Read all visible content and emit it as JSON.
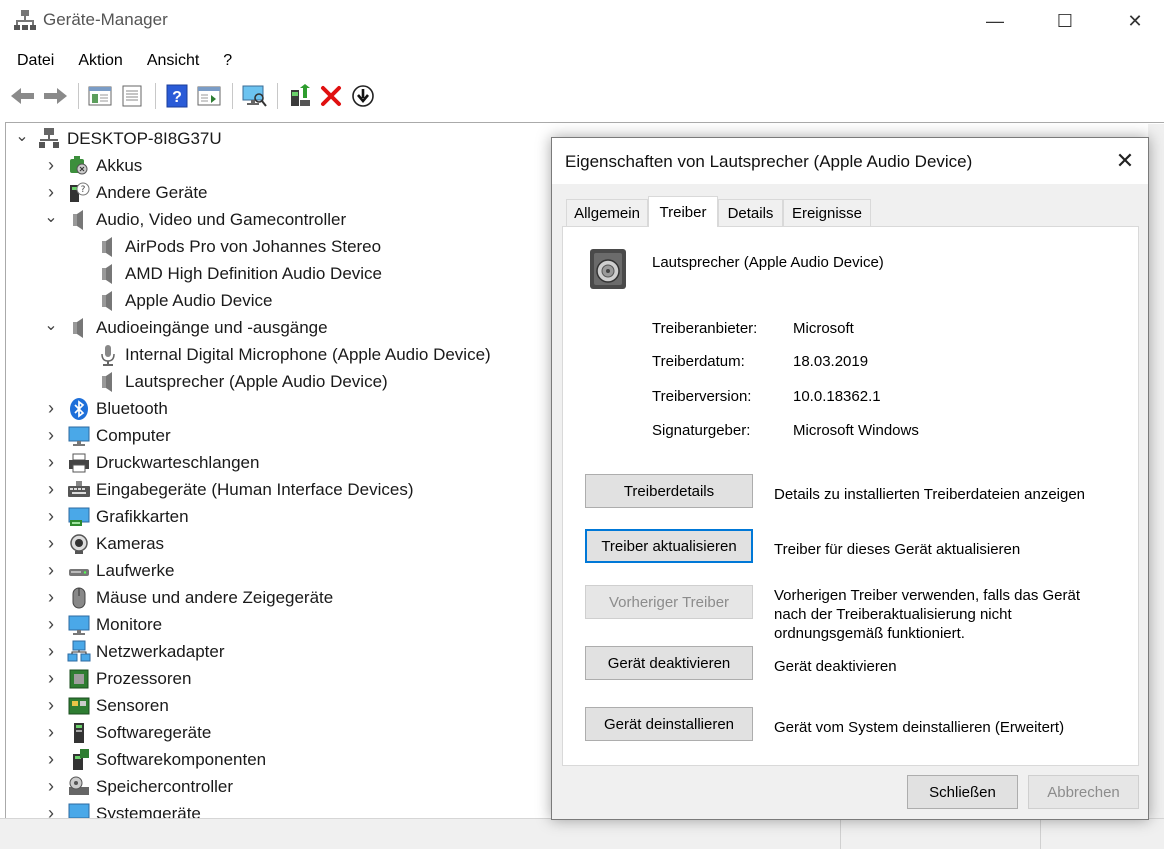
{
  "window": {
    "title": "Geräte-Manager",
    "controls": {
      "minimize": "—",
      "maximize": "☐",
      "close": "✕"
    }
  },
  "menu": [
    "Datei",
    "Aktion",
    "Ansicht",
    "?"
  ],
  "toolbar": [
    "back-arrow-icon",
    "forward-arrow-icon",
    "console-tree-icon",
    "properties-icon",
    "help-icon",
    "action-pane-icon",
    "scan-monitor-icon",
    "update-driver-icon",
    "uninstall-x-icon",
    "download-driver-icon"
  ],
  "tree": [
    {
      "label": "DESKTOP-8I8G37U",
      "level": 0,
      "state": "expanded",
      "icon": "computer-root-icon"
    },
    {
      "label": "Akkus",
      "level": 1,
      "state": "collapsed",
      "icon": "battery-icon"
    },
    {
      "label": "Andere Geräte",
      "level": 1,
      "state": "collapsed",
      "icon": "unknown-device-icon"
    },
    {
      "label": "Audio, Video und Gamecontroller",
      "level": 1,
      "state": "expanded",
      "icon": "speaker-icon"
    },
    {
      "label": "AirPods Pro von Johannes Stereo",
      "level": 2,
      "state": "leaf",
      "icon": "speaker-icon"
    },
    {
      "label": "AMD High Definition Audio Device",
      "level": 2,
      "state": "leaf",
      "icon": "speaker-icon"
    },
    {
      "label": "Apple Audio Device",
      "level": 2,
      "state": "leaf",
      "icon": "speaker-icon"
    },
    {
      "label": "Audioeingänge und -ausgänge",
      "level": 1,
      "state": "expanded",
      "icon": "speaker-icon"
    },
    {
      "label": "Internal Digital Microphone (Apple Audio Device)",
      "level": 2,
      "state": "leaf",
      "icon": "microphone-icon"
    },
    {
      "label": "Lautsprecher (Apple Audio Device)",
      "level": 2,
      "state": "leaf",
      "icon": "speaker-icon"
    },
    {
      "label": "Bluetooth",
      "level": 1,
      "state": "collapsed",
      "icon": "bluetooth-icon"
    },
    {
      "label": "Computer",
      "level": 1,
      "state": "collapsed",
      "icon": "monitor-icon"
    },
    {
      "label": "Druckwarteschlangen",
      "level": 1,
      "state": "collapsed",
      "icon": "printer-icon"
    },
    {
      "label": "Eingabegeräte (Human Interface Devices)",
      "level": 1,
      "state": "collapsed",
      "icon": "keyboard-icon"
    },
    {
      "label": "Grafikkarten",
      "level": 1,
      "state": "collapsed",
      "icon": "display-adapter-icon"
    },
    {
      "label": "Kameras",
      "level": 1,
      "state": "collapsed",
      "icon": "camera-icon"
    },
    {
      "label": "Laufwerke",
      "level": 1,
      "state": "collapsed",
      "icon": "drive-icon"
    },
    {
      "label": "Mäuse und andere Zeigegeräte",
      "level": 1,
      "state": "collapsed",
      "icon": "mouse-icon"
    },
    {
      "label": "Monitore",
      "level": 1,
      "state": "collapsed",
      "icon": "monitor-icon"
    },
    {
      "label": "Netzwerkadapter",
      "level": 1,
      "state": "collapsed",
      "icon": "network-icon"
    },
    {
      "label": "Prozessoren",
      "level": 1,
      "state": "collapsed",
      "icon": "processor-icon"
    },
    {
      "label": "Sensoren",
      "level": 1,
      "state": "collapsed",
      "icon": "sensor-icon"
    },
    {
      "label": "Softwaregeräte",
      "level": 1,
      "state": "collapsed",
      "icon": "software-device-icon"
    },
    {
      "label": "Softwarekomponenten",
      "level": 1,
      "state": "collapsed",
      "icon": "software-component-icon"
    },
    {
      "label": "Speichercontroller",
      "level": 1,
      "state": "collapsed",
      "icon": "storage-controller-icon"
    },
    {
      "label": "Systemgeräte",
      "level": 1,
      "state": "collapsed",
      "icon": "system-device-icon"
    }
  ],
  "dialog": {
    "title": "Eigenschaften von Lautsprecher (Apple Audio Device)",
    "close": "✕",
    "tabs": [
      {
        "label": "Allgemein",
        "active": false
      },
      {
        "label": "Treiber",
        "active": true
      },
      {
        "label": "Details",
        "active": false
      },
      {
        "label": "Ereignisse",
        "active": false
      }
    ],
    "device_name": "Lautsprecher (Apple Audio Device)",
    "properties": [
      {
        "label": "Treiberanbieter:",
        "value": "Microsoft"
      },
      {
        "label": "Treiberdatum:",
        "value": "18.03.2019"
      },
      {
        "label": "Treiberversion:",
        "value": "10.0.18362.1"
      },
      {
        "label": "Signaturgeber:",
        "value": "Microsoft Windows"
      }
    ],
    "actions": [
      {
        "button": "Treiberdetails",
        "description": "Details zu installierten Treiberdateien anzeigen",
        "state": "normal"
      },
      {
        "button": "Treiber aktualisieren",
        "description": "Treiber für dieses Gerät aktualisieren",
        "state": "focused"
      },
      {
        "button": "Vorheriger Treiber",
        "description": "Vorherigen Treiber verwenden, falls das Gerät nach der Treiberaktualisierung nicht ordnungsgemäß funktioniert.",
        "state": "disabled"
      },
      {
        "button": "Gerät deaktivieren",
        "description": "Gerät deaktivieren",
        "state": "normal"
      },
      {
        "button": "Gerät deinstallieren",
        "description": "Gerät vom System deinstallieren (Erweitert)",
        "state": "normal"
      }
    ],
    "footer": {
      "ok": "Schließen",
      "cancel": "Abbrechen"
    }
  }
}
